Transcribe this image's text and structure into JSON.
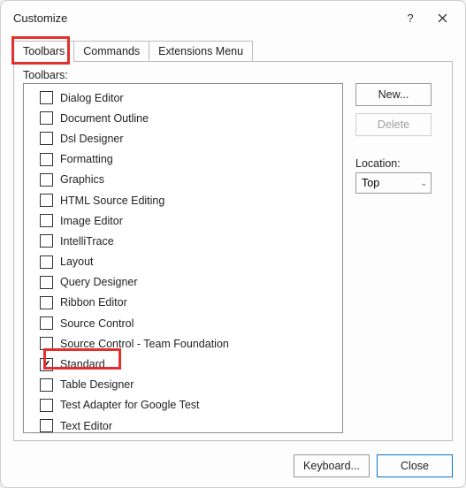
{
  "title": "Customize",
  "help_icon": "?",
  "tabs": [
    {
      "label": "Toolbars",
      "active": true
    },
    {
      "label": "Commands",
      "active": false
    },
    {
      "label": "Extensions Menu",
      "active": false
    }
  ],
  "list_label": "Toolbars:",
  "toolbar_items": [
    {
      "label": "Dialog Editor",
      "checked": false
    },
    {
      "label": "Document Outline",
      "checked": false
    },
    {
      "label": "Dsl Designer",
      "checked": false
    },
    {
      "label": "Formatting",
      "checked": false
    },
    {
      "label": "Graphics",
      "checked": false
    },
    {
      "label": "HTML Source Editing",
      "checked": false
    },
    {
      "label": "Image Editor",
      "checked": false
    },
    {
      "label": "IntelliTrace",
      "checked": false
    },
    {
      "label": "Layout",
      "checked": false
    },
    {
      "label": "Query Designer",
      "checked": false
    },
    {
      "label": "Ribbon Editor",
      "checked": false
    },
    {
      "label": "Source Control",
      "checked": false
    },
    {
      "label": "Source Control - Team Foundation",
      "checked": false
    },
    {
      "label": "Standard",
      "checked": true
    },
    {
      "label": "Table Designer",
      "checked": false
    },
    {
      "label": "Test Adapter for Google Test",
      "checked": false
    },
    {
      "label": "Text Editor",
      "checked": false
    }
  ],
  "buttons": {
    "new": "New...",
    "delete": "Delete",
    "keyboard": "Keyboard...",
    "close": "Close"
  },
  "location": {
    "label": "Location:",
    "value": "Top"
  }
}
